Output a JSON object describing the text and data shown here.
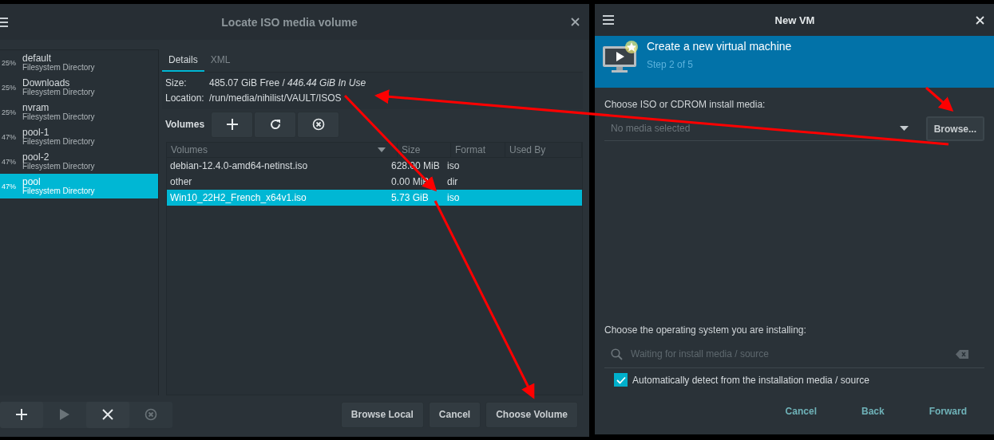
{
  "locate_dialog": {
    "title": "Locate ISO media volume",
    "pools": [
      {
        "usage": "25%",
        "name": "default",
        "type": "Filesystem Directory",
        "selected": false
      },
      {
        "usage": "25%",
        "name": "Downloads",
        "type": "Filesystem Directory",
        "selected": false
      },
      {
        "usage": "25%",
        "name": "nvram",
        "type": "Filesystem Directory",
        "selected": false
      },
      {
        "usage": "47%",
        "name": "pool-1",
        "type": "Filesystem Directory",
        "selected": false
      },
      {
        "usage": "47%",
        "name": "pool-2",
        "type": "Filesystem Directory",
        "selected": false
      },
      {
        "usage": "47%",
        "name": "pool",
        "type": "Filesystem Directory",
        "selected": true
      }
    ],
    "tabs": [
      {
        "label": "Details",
        "selected": true
      },
      {
        "label": "XML",
        "selected": false
      }
    ],
    "size_label": "Size:",
    "size_value": "485.07 GiB Free / *446.44 GiB In Use*",
    "location_label": "Location:",
    "location_value": "/run/media/nihilist/VAULT/ISOS",
    "volumes_label": "Volumes",
    "volume_tools": [
      {
        "kind": "add"
      },
      {
        "kind": "refresh"
      },
      {
        "kind": "delete"
      }
    ],
    "columns": [
      "Volumes",
      "Size",
      "Format",
      "Used By"
    ],
    "rows": [
      {
        "name": "debian-12.4.0-amd64-netinst.iso",
        "size": "628.00 MiB",
        "format": "iso",
        "selected": false
      },
      {
        "name": "other",
        "size": "0.00 MiB",
        "format": "dir",
        "selected": false
      },
      {
        "name": "Win10_22H2_French_x64v1.iso",
        "size": "5.73 GiB",
        "format": "iso",
        "selected": true
      }
    ],
    "pool_tools": [
      {
        "kind": "add",
        "disabled": false
      },
      {
        "kind": "start",
        "disabled": true
      },
      {
        "kind": "stop",
        "disabled": false
      },
      {
        "kind": "delete",
        "disabled": true
      }
    ],
    "buttons": [
      "Browse Local",
      "Cancel",
      "Choose Volume"
    ]
  },
  "new_vm": {
    "title": "New VM",
    "heading": "Create a new virtual machine",
    "step": "Step 2 of 5",
    "media_label": "Choose ISO or CDROM install media:",
    "media_placeholder": "No media selected",
    "browse_button": "Browse...",
    "os_label": "Choose the operating system you are installing:",
    "os_placeholder": "Waiting for install media / source",
    "auto_detect": {
      "label": "Automatically detect from the installation media / source",
      "checked": true
    },
    "buttons": [
      "Cancel",
      "Back",
      "Forward"
    ]
  }
}
